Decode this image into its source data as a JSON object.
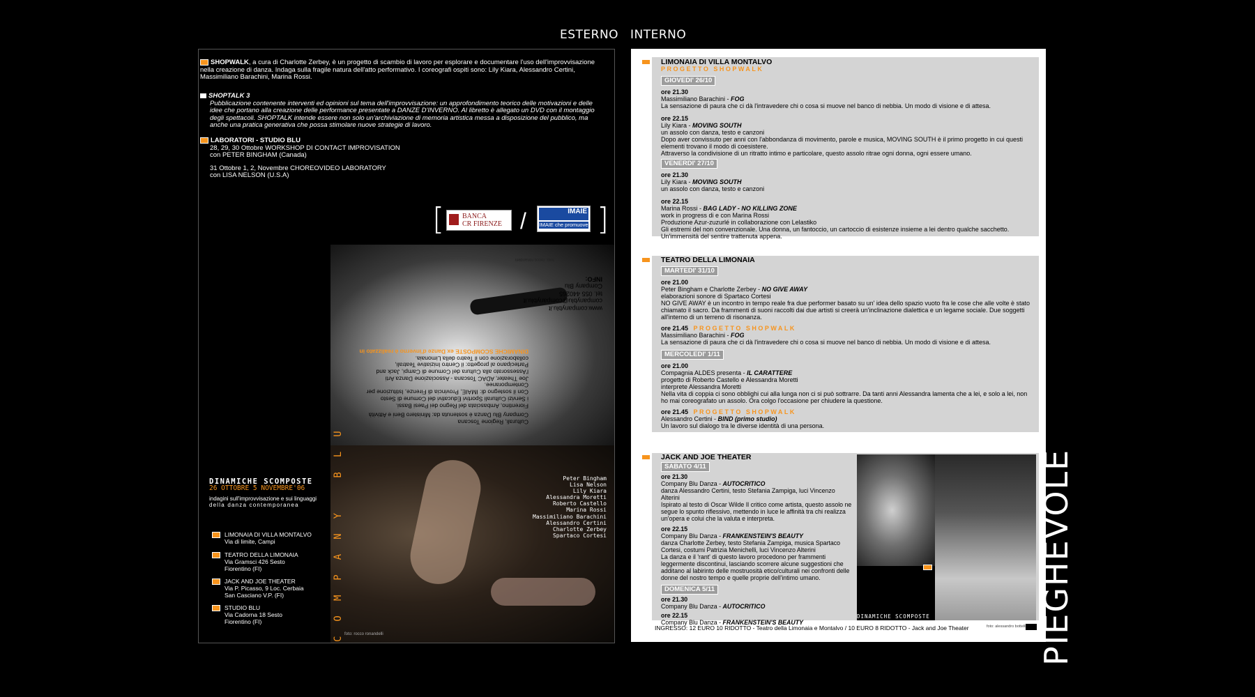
{
  "header": {
    "esterno": "ESTERNO",
    "interno": "INTERNO"
  },
  "side_label": "PIEGHEVOLE",
  "left": {
    "shopwalk_title": "SHOPWALK",
    "shopwalk_text": ", a cura di Charlotte Zerbey, è un progetto di scambio di lavoro per esplorare e documentare l'uso dell'improvvisazione nella creazione di danza. Indaga sulla fragile natura dell'atto performativo. I coreografi ospiti sono: Lily Kiara, Alessandro Certini, Massimiliano Barachini, Marina Rossi.",
    "shoptalk_title": "SHOPTALK 3",
    "shoptalk_text": "Pubblicazione contenente interventi ed opinioni sul tema dell'improvvisazione: un approfondimento teorico delle motivazioni e delle idee che portano alla creazione delle performance presentate a DANZE D'INVERNO. Al libretto è allegato un DVD con il montaggio degli spettacoli. SHOPTALK intende essere non solo un'archiviazione di memoria artistica messa a disposizione del pubblico, ma anche una pratica generativa che possa stimolare nuove strategie di lavoro.",
    "lab_title": "LABORATORI - STUDIO BLU",
    "lab_1": "28, 29, 30  Ottobre  WORKSHOP DI CONTACT IMPROVISATION",
    "lab_1b": "con PETER BINGHAM (Canada)",
    "lab_2": "31 Ottobre 1, 2,  Novembre CHOREOVIDEO LABORATORY",
    "lab_2b": "con LISA NELSON (U.S.A)",
    "bank_1": "BANCA",
    "bank_2": "CR FIRENZE",
    "slash": "/",
    "imaie_logo": "IMAIE",
    "imaie_tag": "IMAIE che promuove",
    "info_title": "INFO:",
    "info_1": "Company Blu",
    "info_2": "tel. 055 440265",
    "info_3": "companyblu@companyblu.it",
    "info_4": "www.companyblu.it",
    "foto_top": "foto: rocco ronandelli",
    "flip_1": "DINAMICHE SCOMPOSTE ex Danze d'inverno è realizzato in",
    "flip_2": "collaborazione con il Teatro della Limonaia.",
    "flip_3": "Partecipano al progetto: il Centro Iniziative Teatrali,",
    "flip_4": "l'Assessorato alla Cultura del Comune di Campi, Jack and",
    "flip_5": "Joe Theater, ADAC Toscana - Associazione Danza Arti",
    "flip_6": "Contemporanee.",
    "flip_7": "Con il sostegno di: IMAIE, Provincia di Firenze, Istituzione per",
    "flip_8": "i Servizi Culturali Sportivi Educativi del Comune di Sesto",
    "flip_9": "Fiorentino, Ambasciata del Regno dei Paesi Bassi.",
    "flip_10": "Company Blu Danza è sostenuta da: Ministero Beni e Attività",
    "flip_11": "Culturali, Regione Toscana",
    "company": "COMPANY BLU",
    "names": [
      "Peter Bingham",
      "Lisa Nelson",
      "Lily Kiara",
      "Alessandra Moretti",
      "Roberto Castello",
      "Marina Rossi",
      "Massimiliano Barachini",
      "Alessandro Certini",
      "Charlotte Zerbey",
      "Spartaco Cortesi"
    ],
    "event_title": "DINAMICHE SCOMPOSTE",
    "event_date": "26 OTTOBRE 5 NOVEMBRE'06",
    "event_sub_1": "indagini sull'improvvisazione e sui linguaggi",
    "event_sub_2": "della  danza  contemporanea",
    "venues": [
      {
        "name": "LIMONAIA DI VILLA MONTALVO",
        "l1": "Via di limite, Campi",
        "l2": ""
      },
      {
        "name": "TEATRO DELLA LIMONAIA",
        "l1": "Via Gramsci  426 Sesto",
        "l2": "Fiorentino (FI)"
      },
      {
        "name": "JACK AND JOE THEATER",
        "l1": "Via P. Picasso, 9 Loc. Cerbaia",
        "l2": "San Casciano V.P. (FI)"
      },
      {
        "name": "STUDIO BLU",
        "l1": "Via Cadorna 18 Sesto",
        "l2": "Fiorentino (FI)"
      }
    ],
    "foto_bottom": "foto: rocco ronandelli"
  },
  "right": {
    "s1": {
      "title": "LIMONAIA  DI VILLA MONTALVO",
      "sub": "PROGETTO SHOPWALK",
      "d1": "GIOVEDI' 26/10",
      "d1_t1": "ore 21.30",
      "d1_a1": "Massimiliano Barachini - ",
      "d1_w1": "FOG",
      "d1_x1": "La sensazione di paura che ci dà l'intravedere chi o cosa si muove nel banco di nebbia. Un modo di visione e di attesa.",
      "d1_t2": "ore 22.15",
      "d1_a2": "Lily Kiara - ",
      "d1_w2": "MOVING SOUTH",
      "d1_x2a": "un assolo con danza, testo e canzoni",
      "d1_x2b": "Dopo aver convissuto per anni con l'abbondanza di movimento, parole e musica, MOVING SOUTH è il primo progetto in cui questi elementi trovano il modo di coesistere.",
      "d1_x2c": "Attraverso la condivisione di un ritratto intimo e particolare, questo assolo ritrae ogni donna, ogni essere umano.",
      "d2": "VENERDI' 27/10",
      "d2_t1": "ore 21.30",
      "d2_a1": "Lily Kiara - ",
      "d2_w1": "MOVING SOUTH",
      "d2_x1": "un assolo con danza, testo e canzoni",
      "d2_t2": "ore 22.15",
      "d2_a2": "Marina Rossi - ",
      "d2_w2": "BAG LADY - NO KILLING ZONE",
      "d2_x2a": "work in progress di e con Marina Rossi",
      "d2_x2b": "Produzione Azur-zuzurlé in collaborazione con Lelastiko",
      "d2_x2c": "Gli estremi del non convenzionale. Una donna, un fantoccio, un cartoccio di  esistenze insieme a lei dentro qualche sacchetto.",
      "d2_x2d": "Un'immensità del sentire trattenuta appena."
    },
    "s2": {
      "title": "TEATRO  DELLA  LIMONAIA",
      "d1": "MARTEDI' 31/10",
      "d1_t1": "ore 21.00",
      "d1_a1": "Peter Bingham e Charlotte Zerbey - ",
      "d1_w1": "NO GIVE AWAY",
      "d1_x1a": "elaborazioni sonore di Spartaco Cortesi",
      "d1_x1b": "NO GIVE AWAY è un incontro in tempo reale fra due performer basato su un' idea dello spazio vuoto fra le cose che alle volte è stato chiamato il sacro. Da frammenti di suoni raccolti dai due artisti si creerà un'inclinazione dialettica e un legame sociale. Due soggetti all'interno di un terreno di risonanza.",
      "d1_t2": "ore 21.45",
      "d1_p2": "PROGETTO SHOPWALK",
      "d1_a2": "Massimiliano Barachini - ",
      "d1_w2": "FOG",
      "d1_x2": "La sensazione di paura che ci dà l'intravedere chi o cosa si muove nel banco di nebbia. Un modo di visione e di attesa.",
      "d2": "MERCOLEDI' 1/11",
      "d2_t1": "ore 21.00",
      "d2_a1": "Compagnia ALDES presenta - ",
      "d2_w1": "IL CARATTERE",
      "d2_x1a": "progetto di Roberto Castello e Alessandra Moretti",
      "d2_x1b": "interprete Alessandra Moretti",
      "d2_x1c": "Nella vita di coppia ci sono obblighi cui alla lunga non ci si può sottrarre. Da tanti anni Alessandra lamenta che a lei, e solo a lei, non ho mai coreografato un assolo. Ora colgo l'occasione per chiudere la questione.",
      "d2_t2": "ore 21.45",
      "d2_p2": "PROGETTO SHOPWALK",
      "d2_a2": "Alessandro Certini - ",
      "d2_w2": "BIND (primo studio)",
      "d2_x2": "Un lavoro sul dialogo tra le diverse identità di una persona."
    },
    "s3": {
      "title": "JACK AND JOE THEATER",
      "d1": "SABATO 4/11",
      "d1_t1": "ore 21.30",
      "d1_a1": "Company Blu Danza - ",
      "d1_w1": "AUTOCRITICO",
      "d1_x1a": "danza Alessandro Certini, testo Stefania Zampiga, luci Vincenzo Alterini",
      "d1_x1b": "Ispirato al testo di Oscar Wilde Il critico come artista, questo assolo ne segue lo spunto riflessivo, mettendo in luce le affinità tra chi realizza un'opera e colui che la valuta e interpreta.",
      "d1_t2": "ore 22.15",
      "d1_a2": "Company Blu Danza - ",
      "d1_w2": "FRANKENSTEIN'S BEAUTY",
      "d1_x2a": "danza Charlotte Zerbey, testo Stefania Zampiga, musica Spartaco Cortesi, costumi Patrizia Menichelli, luci Vincenzo Alterini",
      "d1_x2b": "La danza e il 'rant' di questo lavoro procedono per frammenti leggermente discontinui, lasciando scorrere alcune suggestioni che additano al labirinto delle mostruosità etico/culturali nei confronti delle donne del nostro tempo e quelle proprie dell'intimo umano.",
      "d2": "DOMENICA 5/11",
      "d2_t1": "ore 21.30",
      "d2_a1": "Company Blu Danza - ",
      "d2_w1": "AUTOCRITICO",
      "d2_t2": "ore 22.15",
      "d2_a2": "Company Blu Danza - ",
      "d2_w2": "FRANKENSTEIN'S BEAUTY",
      "photo_caption": "DINAMICHE   SCOMPOSTE",
      "foto": "foto: alessandro bottelli"
    },
    "ingresso": "INGRESSO: 12 EURO 10 RIDOTTO - Teatro della Limonaia e Montalvo / 10 EURO 8 RIDOTTO - Jack and Joe Theater"
  },
  "colors": {
    "orange": "#f7941d",
    "panel_grey": "#d4d4d4",
    "day_grey": "#9c9c9c"
  }
}
